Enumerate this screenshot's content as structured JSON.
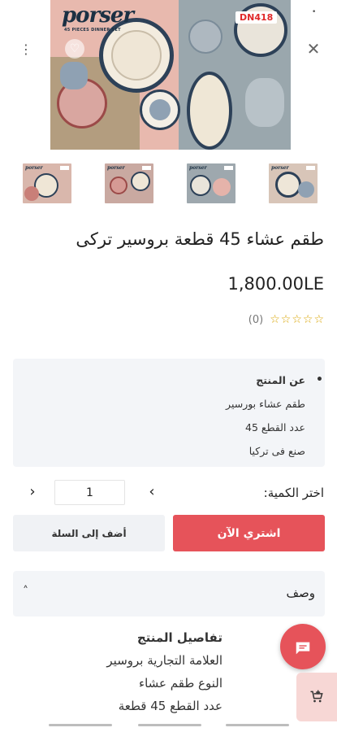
{
  "hero": {
    "brand": "porser",
    "brand_sub": "45 PIECES DINNER SET",
    "badge": "DN418",
    "close_icon": "close-icon",
    "menu_icon": "more-vert-icon",
    "fav_icon": "heart-icon",
    "dot": "•"
  },
  "thumbnails": [
    {
      "logo": "porser"
    },
    {
      "logo": "porser"
    },
    {
      "logo": "porser"
    },
    {
      "logo": "porser"
    }
  ],
  "product": {
    "title": "طقم عشاء 45 قطعة بروسير تركى",
    "price": "1,800.00LE",
    "stars": [
      "☆",
      "☆",
      "☆",
      "☆",
      "☆"
    ],
    "review_count": "(0)"
  },
  "about": {
    "heading": "عن المنتج",
    "items": [
      "طقم عشاء بورسير",
      "عدد القطع 45",
      "صنع فى تركيا"
    ]
  },
  "quantity": {
    "label": "اختر الكمية:",
    "value": "1",
    "prev": "‹",
    "next": "›"
  },
  "buttons": {
    "buy_now": "اشتري الآن",
    "add_to_cart": "أضف إلى السلة"
  },
  "description": {
    "label": "وصف",
    "chevron": "˄",
    "lines": [
      "تفاصيل المنتج",
      "العلامة التجارية بروسير",
      "النوع طقم عشاء",
      "عدد القطع 45 قطعة"
    ]
  },
  "floating": {
    "chat_icon": "chat-icon",
    "cart_icon": "cart-plus-icon"
  },
  "colors": {
    "primary": "#e6535a",
    "secondary_bg": "#f0f2f5",
    "star": "#d9a400"
  }
}
